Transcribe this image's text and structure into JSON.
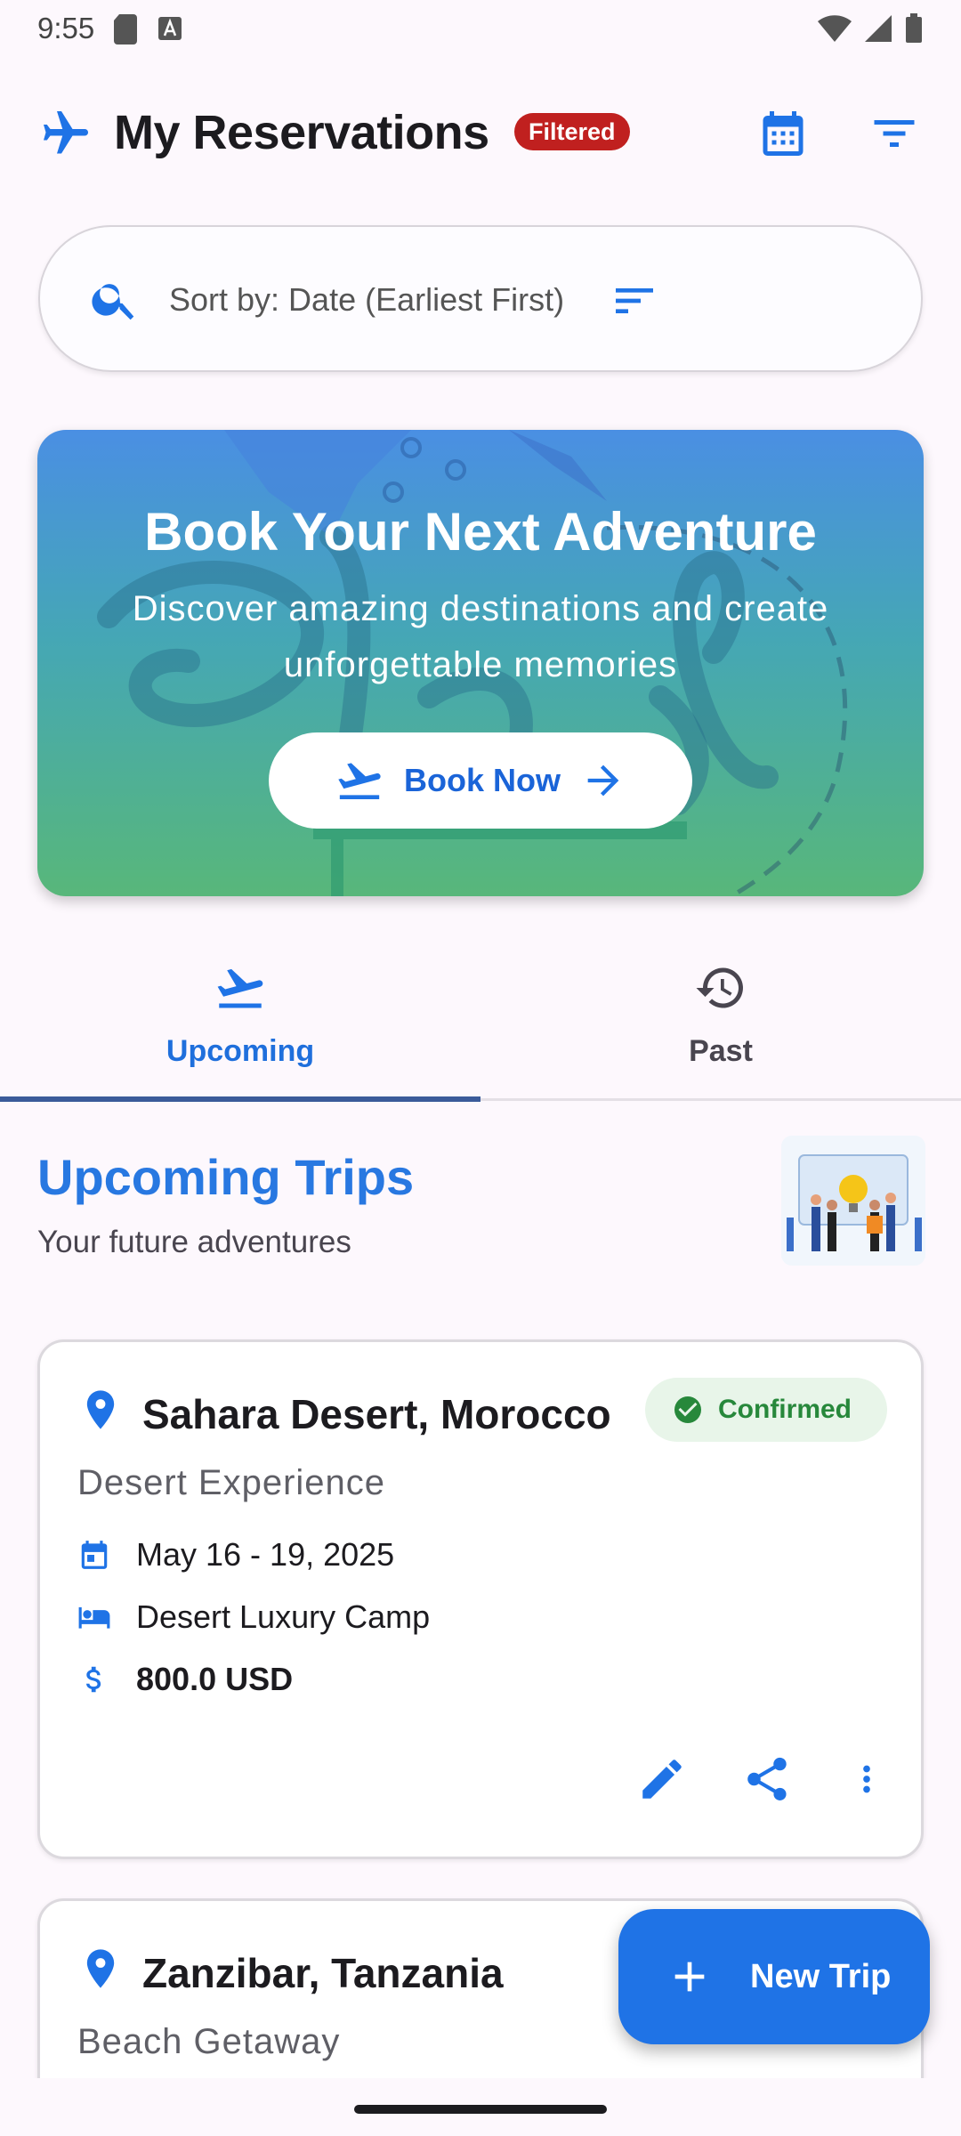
{
  "status_bar": {
    "time": "9:55"
  },
  "app_bar": {
    "title": "My Reservations",
    "filter_badge": "Filtered"
  },
  "sort": {
    "label": "Sort by: Date (Earliest First)"
  },
  "banner": {
    "title": "Book Your Next Adventure",
    "subtitle": "Discover amazing destinations and create unforgettable memories",
    "button_label": "Book Now"
  },
  "tabs": [
    {
      "label": "Upcoming",
      "active": true
    },
    {
      "label": "Past",
      "active": false
    }
  ],
  "section": {
    "title": "Upcoming Trips",
    "subtitle": "Your future adventures"
  },
  "reservations": [
    {
      "destination": "Sahara Desert, Morocco",
      "type": "Desert Experience",
      "status": "Confirmed",
      "dates": "May 16 - 19, 2025",
      "accommodation": "Desert Luxury Camp",
      "price": "800.0 USD"
    },
    {
      "destination": "Zanzibar, Tanzania",
      "type": "Beach Getaway"
    }
  ],
  "fab": {
    "label": "New Trip"
  },
  "colors": {
    "primary": "#1f73e6",
    "badge_red": "#c0201f",
    "confirmed_green": "#27883b"
  }
}
